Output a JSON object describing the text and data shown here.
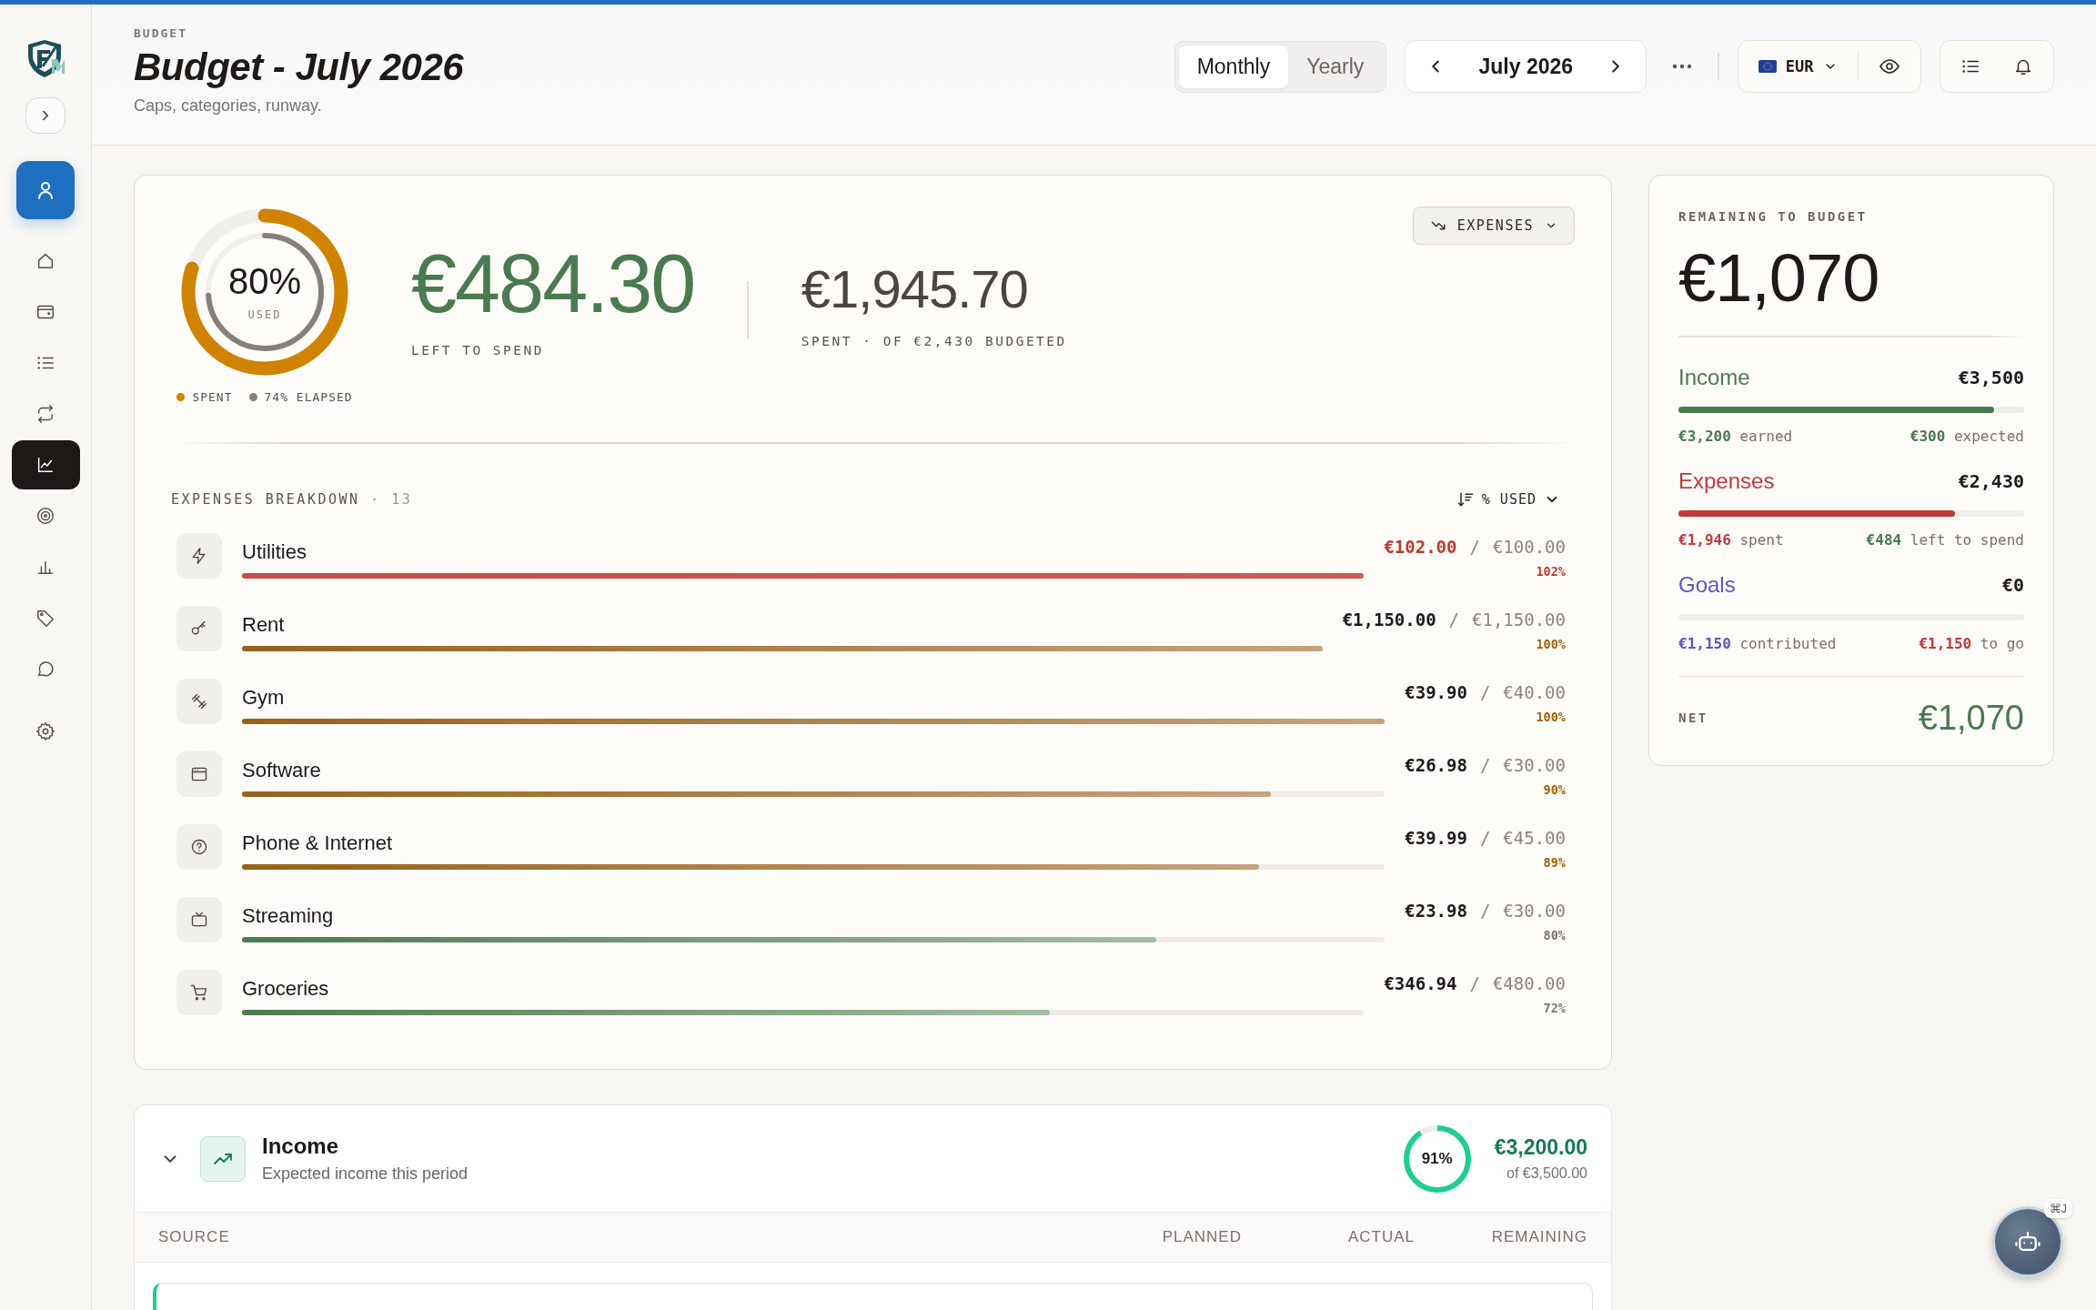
{
  "sidebar": {
    "nav_items": [
      {
        "selected": false
      },
      {
        "selected": false
      },
      {
        "selected": false
      },
      {
        "selected": false
      },
      {
        "selected": true
      },
      {
        "selected": false
      },
      {
        "selected": false
      },
      {
        "selected": false
      },
      {
        "selected": false
      },
      {
        "selected": false
      }
    ]
  },
  "header": {
    "eyebrow": "BUDGET",
    "title": "Budget - July 2026",
    "subtitle": "Caps, categories, runway.",
    "period_tabs": [
      {
        "label": "Monthly",
        "selected": true
      },
      {
        "label": "Yearly",
        "selected": false
      }
    ],
    "month": "July 2026",
    "currency": "EUR"
  },
  "overview": {
    "used": {
      "level": 0.8,
      "value": "80%",
      "label": "USED"
    },
    "elapsed": {
      "level": 0.74
    },
    "legend": [
      "SPENT",
      "74% ELAPSED"
    ],
    "left_amount": "€484.30",
    "left_label": "LEFT TO SPEND",
    "spent_amount": "€1,945.70",
    "spent_label": "SPENT · OF €2,430 BUDGETED",
    "type_button": "EXPENSES"
  },
  "breakdown": {
    "title": "EXPENSES BREAKDOWN",
    "count": "· 13",
    "sort": "% USED",
    "rows": [
      {
        "name": "Utilities",
        "kind": "over",
        "level": 1,
        "spent": "€102.00",
        "separator": "/",
        "budget": "€100.00",
        "percent": "102%"
      },
      {
        "name": "Rent",
        "kind": "warning",
        "level": 1,
        "spent": "€1,150.00",
        "separator": "/",
        "budget": "€1,150.00",
        "percent": "100%"
      },
      {
        "name": "Gym",
        "kind": "warning",
        "level": 1,
        "spent": "€39.90",
        "separator": "/",
        "budget": "€40.00",
        "percent": "100%"
      },
      {
        "name": "Software",
        "kind": "warning",
        "level": 0.9,
        "spent": "€26.98",
        "separator": "/",
        "budget": "€30.00",
        "percent": "90%"
      },
      {
        "name": "Phone & Internet",
        "kind": "warning",
        "level": 0.89,
        "spent": "€39.99",
        "separator": "/",
        "budget": "€45.00",
        "percent": "89%"
      },
      {
        "name": "Streaming",
        "kind": "ok",
        "level": 0.8,
        "spent": "€23.98",
        "separator": "/",
        "budget": "€30.00",
        "percent": "80%"
      },
      {
        "name": "Groceries",
        "kind": "ok",
        "level": 0.72,
        "spent": "€346.94",
        "separator": "/",
        "budget": "€480.00",
        "percent": "72%"
      }
    ]
  },
  "summary": {
    "label": "REMAINING TO BUDGET",
    "amount": "€1,070",
    "sections": [
      {
        "kind": "income",
        "label": "Income",
        "total": "€3,500",
        "level": 0.914,
        "left": {
          "text": "**€3,200** earned",
          "kind": "positive"
        },
        "right": {
          "text": "**€300** expected",
          "kind": "positive"
        }
      },
      {
        "kind": "expenses",
        "label": "Expenses",
        "total": "€2,430",
        "level": 0.8,
        "left": {
          "text": "**€1,946** spent",
          "kind": "negative"
        },
        "right": {
          "text": "**€484** left to spend",
          "kind": "positive"
        }
      },
      {
        "kind": "goals",
        "label": "Goals",
        "total": "€0",
        "left": {
          "text": "**€1,150** contributed",
          "kind": "goal"
        },
        "right": {
          "text": "**€1,150** to go",
          "kind": "negative"
        }
      }
    ],
    "net_label": "NET",
    "net_amount": "€1,070"
  },
  "income": {
    "expanded": true,
    "title": "Income",
    "subtitle": "Expected income this period",
    "progress": {
      "level": 0.91,
      "value": "91%"
    },
    "amount": "€3,200.00",
    "of": "of €3,500.00",
    "columns": [
      "SOURCE",
      "PLANNED",
      "ACTUAL",
      "REMAINING"
    ]
  },
  "assistant": {
    "shortcut": "⌘J"
  }
}
